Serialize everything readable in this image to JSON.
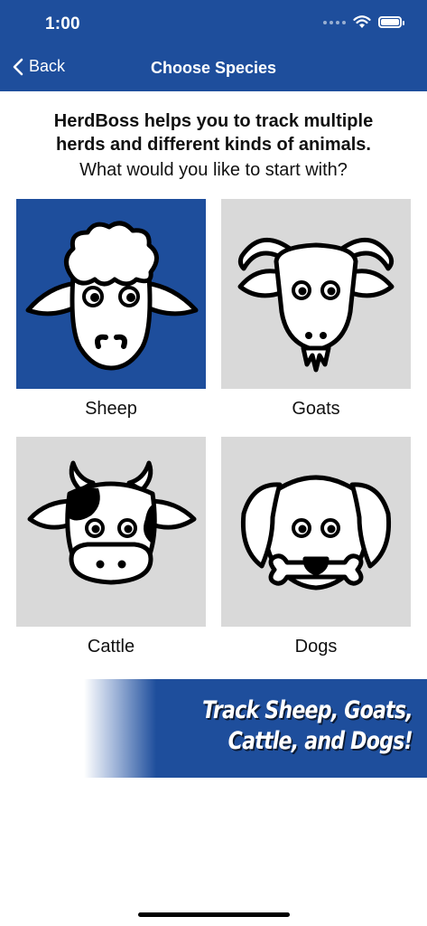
{
  "status_bar": {
    "time": "1:00"
  },
  "nav": {
    "back_label": "Back",
    "title": "Choose Species"
  },
  "intro": {
    "line1": "HerdBoss helps you to track multiple",
    "line2": "herds and different kinds of animals.",
    "question": "What would you like to start with?"
  },
  "species": [
    {
      "label": "Sheep",
      "icon": "sheep-icon",
      "selected": true
    },
    {
      "label": "Goats",
      "icon": "goat-icon",
      "selected": false
    },
    {
      "label": "Cattle",
      "icon": "cow-icon",
      "selected": false
    },
    {
      "label": "Dogs",
      "icon": "dog-icon",
      "selected": false
    }
  ],
  "banner": {
    "line1": "Track Sheep, Goats,",
    "line2": "Cattle, and Dogs!"
  },
  "colors": {
    "brand": "#1e4e9c",
    "tile_unselected": "#d9d9d9"
  }
}
